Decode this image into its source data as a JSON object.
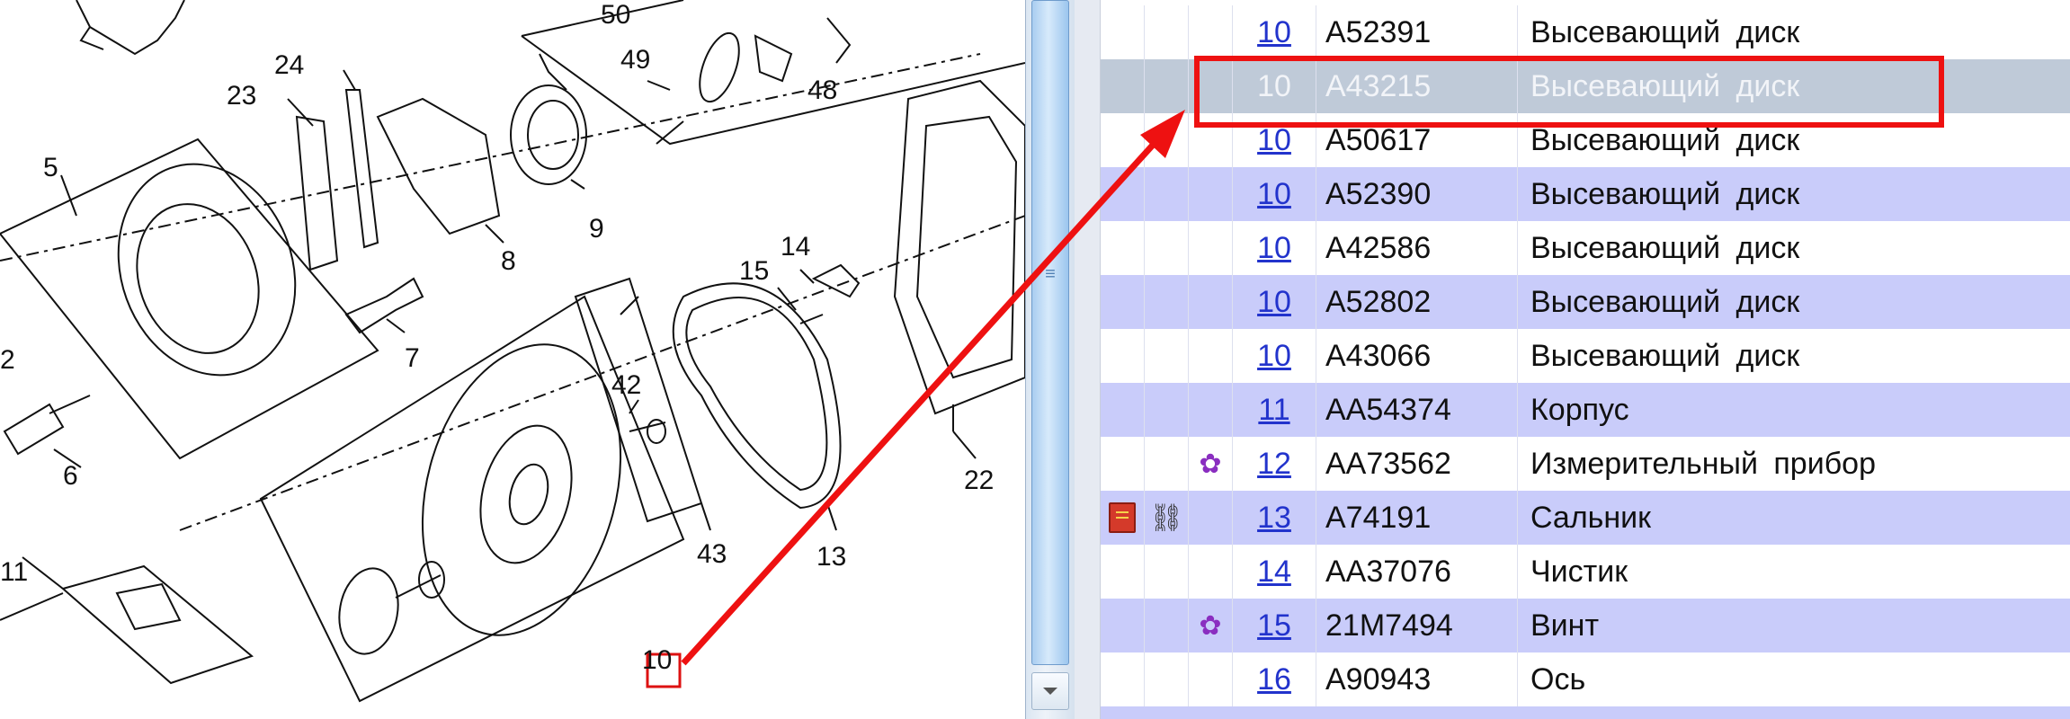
{
  "diagram": {
    "callouts": [
      {
        "label": "50"
      },
      {
        "label": "49"
      },
      {
        "label": "48"
      },
      {
        "label": "24"
      },
      {
        "label": "23"
      },
      {
        "label": "5"
      },
      {
        "label": "9"
      },
      {
        "label": "8"
      },
      {
        "label": "7"
      },
      {
        "label": "14"
      },
      {
        "label": "15"
      },
      {
        "label": "2"
      },
      {
        "label": "6"
      },
      {
        "label": "42"
      },
      {
        "label": "22"
      },
      {
        "label": "43"
      },
      {
        "label": "13"
      },
      {
        "label": "11"
      },
      {
        "label": "10"
      }
    ]
  },
  "parts": [
    {
      "ref": "10",
      "part_no": "A52391",
      "description": "Высевающий диск",
      "icons": []
    },
    {
      "ref": "10",
      "part_no": "A43215",
      "description": "Высевающий диск",
      "icons": [],
      "selected": true
    },
    {
      "ref": "10",
      "part_no": "A50617",
      "description": "Высевающий диск",
      "icons": []
    },
    {
      "ref": "10",
      "part_no": "A52390",
      "description": "Высевающий диск",
      "icons": []
    },
    {
      "ref": "10",
      "part_no": "A42586",
      "description": "Высевающий диск",
      "icons": []
    },
    {
      "ref": "10",
      "part_no": "A52802",
      "description": "Высевающий диск",
      "icons": []
    },
    {
      "ref": "10",
      "part_no": "A43066",
      "description": "Высевающий диск",
      "icons": []
    },
    {
      "ref": "11",
      "part_no": "AA54374",
      "description": "Корпус",
      "icons": []
    },
    {
      "ref": "12",
      "part_no": "AA73562",
      "description": "Измерительный прибор",
      "icons": [
        "flower-icon"
      ]
    },
    {
      "ref": "13",
      "part_no": "A74191",
      "description": "Сальник",
      "icons": [
        "notebook-icon",
        "chain-link-icon"
      ]
    },
    {
      "ref": "14",
      "part_no": "AA37076",
      "description": "Чистик",
      "icons": []
    },
    {
      "ref": "15",
      "part_no": "21M7494",
      "description": "Винт",
      "icons": [
        "flower-icon"
      ]
    },
    {
      "ref": "16",
      "part_no": "A90943",
      "description": "Ось",
      "icons": []
    }
  ],
  "colors": {
    "highlight": "#ee1111",
    "row_alt": "#c9ccfa",
    "row_selected": "#bfcad8",
    "link": "#2233cc",
    "icon_flower": "#8a2ec0"
  }
}
